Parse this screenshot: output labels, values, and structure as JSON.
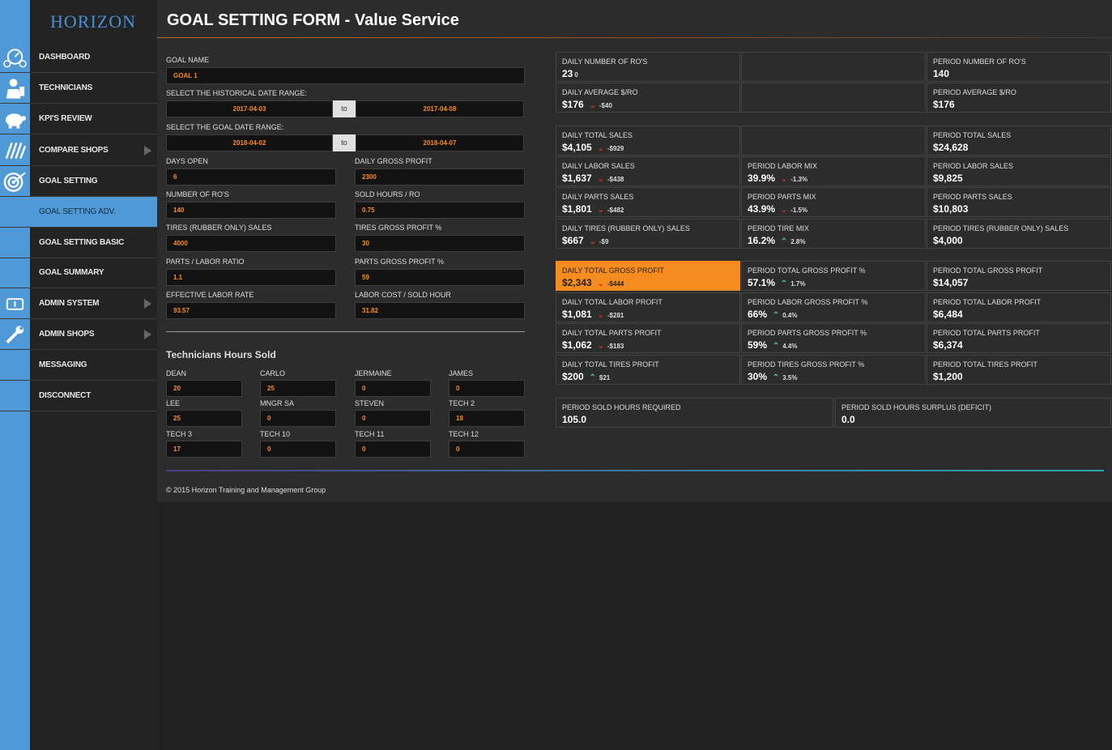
{
  "brand": "HORIZON",
  "page_title": "GOAL SETTING FORM - Value Service",
  "nav": [
    {
      "label": "DASHBOARD",
      "icon": "dashboard-icon"
    },
    {
      "label": "TECHNICIANS",
      "icon": "technician-icon"
    },
    {
      "label": "KPI'S REVIEW",
      "icon": "piggy-bank-icon"
    },
    {
      "label": "COMPARE SHOPS",
      "icon": "compare-icon"
    },
    {
      "label": "GOAL SETTING",
      "icon": "target-icon"
    },
    {
      "label": "GOAL SETTING ADV."
    },
    {
      "label": "GOAL SETTING BASIC"
    },
    {
      "label": "GOAL SUMMARY"
    },
    {
      "label": "ADMIN SYSTEM",
      "icon": "info-icon"
    },
    {
      "label": "ADMIN SHOPS",
      "icon": "wrench-icon"
    },
    {
      "label": "MESSAGING"
    },
    {
      "label": "DISCONNECT"
    }
  ],
  "form": {
    "goal_name_label": "GOAL NAME",
    "goal_name": "GOAL 1",
    "hist_label": "SELECT THE HISTORICAL DATE RANGE:",
    "hist_from": "2017-04-03",
    "hist_to": "2017-04-08",
    "goal_label": "SELECT THE GOAL DATE RANGE:",
    "goal_from": "2018-04-02",
    "goal_to": "2018-04-07",
    "to": "to",
    "fields": [
      {
        "label": "DAYS OPEN",
        "value": "6"
      },
      {
        "label": "DAILY GROSS PROFIT",
        "value": "2300"
      },
      {
        "label": "NUMBER OF RO'S",
        "value": "140"
      },
      {
        "label": "SOLD HOURS / RO",
        "value": "0.75"
      },
      {
        "label": "TIRES (RUBBER ONLY) SALES",
        "value": "4000"
      },
      {
        "label": "TIRES GROSS PROFIT %",
        "value": "30"
      },
      {
        "label": "PARTS / LABOR RATIO",
        "value": "1.1"
      },
      {
        "label": "PARTS GROSS PROFIT %",
        "value": "59"
      },
      {
        "label": "EFFECTIVE LABOR RATE",
        "value": "93.57"
      },
      {
        "label": "LABOR COST / SOLD HOUR",
        "value": "31.82"
      }
    ]
  },
  "technicians": {
    "title": "Technicians Hours Sold",
    "items": [
      {
        "name": "DEAN",
        "hours": "20"
      },
      {
        "name": "CARLO",
        "hours": "25"
      },
      {
        "name": "JERMAINE",
        "hours": "0"
      },
      {
        "name": "JAMES",
        "hours": "0"
      },
      {
        "name": "LEE",
        "hours": "25"
      },
      {
        "name": "MNGR SA",
        "hours": "0"
      },
      {
        "name": "STEVEN",
        "hours": "0"
      },
      {
        "name": "TECH 2",
        "hours": "18"
      },
      {
        "name": "TECH 3",
        "hours": "17"
      },
      {
        "name": "TECH 10",
        "hours": "0"
      },
      {
        "name": "TECH 11",
        "hours": "0"
      },
      {
        "name": "TECH 12",
        "hours": "0"
      }
    ]
  },
  "cards": [
    {
      "label": "DAILY NUMBER OF RO'S",
      "value": "23",
      "delta": "0"
    },
    {
      "label": "",
      "value": ""
    },
    {
      "label": "PERIOD NUMBER OF RO'S",
      "value": "140"
    },
    {
      "label": "DAILY AVERAGE $/RO",
      "value": "$176",
      "delta": "-$40",
      "dir": "down"
    },
    {
      "label": "",
      "value": ""
    },
    {
      "label": "PERIOD AVERAGE $/RO",
      "value": "$176"
    },
    {
      "label": "DAILY TOTAL SALES",
      "value": "$4,105",
      "delta": "-$929",
      "dir": "down"
    },
    {
      "label": "",
      "value": ""
    },
    {
      "label": "PERIOD TOTAL SALES",
      "value": "$24,628"
    },
    {
      "label": "DAILY LABOR SALES",
      "value": "$1,637",
      "delta": "-$438",
      "dir": "down"
    },
    {
      "label": "PERIOD LABOR MIX",
      "value": "39.9%",
      "delta": "-1.3%",
      "dir": "down"
    },
    {
      "label": "PERIOD LABOR SALES",
      "value": "$9,825"
    },
    {
      "label": "DAILY PARTS SALES",
      "value": "$1,801",
      "delta": "-$482",
      "dir": "down"
    },
    {
      "label": "PERIOD PARTS MIX",
      "value": "43.9%",
      "delta": "-1.5%",
      "dir": "down"
    },
    {
      "label": "PERIOD PARTS SALES",
      "value": "$10,803"
    },
    {
      "label": "DAILY TIRES (RUBBER ONLY) SALES",
      "value": "$667",
      "delta": "-$9",
      "dir": "down"
    },
    {
      "label": "PERIOD TIRE MIX",
      "value": "16.2%",
      "delta": "2.8%",
      "dir": "up"
    },
    {
      "label": "PERIOD TIRES (RUBBER ONLY) SALES",
      "value": "$4,000"
    },
    {
      "label": "DAILY TOTAL GROSS PROFIT",
      "value": "$2,343",
      "delta": "-$444",
      "dir": "down",
      "highlight": true
    },
    {
      "label": "PERIOD TOTAL GROSS PROFIT %",
      "value": "57.1%",
      "delta": "1.7%",
      "dir": "up"
    },
    {
      "label": "PERIOD TOTAL GROSS PROFIT",
      "value": "$14,057"
    },
    {
      "label": "DAILY TOTAL LABOR PROFIT",
      "value": "$1,081",
      "delta": "-$281",
      "dir": "down"
    },
    {
      "label": "PERIOD LABOR GROSS PROFIT %",
      "value": "66%",
      "delta": "0.4%",
      "dir": "up"
    },
    {
      "label": "PERIOD TOTAL LABOR PROFIT",
      "value": "$6,484"
    },
    {
      "label": "DAILY TOTAL PARTS PROFIT",
      "value": "$1,062",
      "delta": "-$183",
      "dir": "down"
    },
    {
      "label": "PERIOD PARTS GROSS PROFIT %",
      "value": "59%",
      "delta": "4.4%",
      "dir": "up"
    },
    {
      "label": "PERIOD TOTAL PARTS PROFIT",
      "value": "$6,374"
    },
    {
      "label": "DAILY TOTAL TIRES PROFIT",
      "value": "$200",
      "delta": "$21",
      "dir": "up"
    },
    {
      "label": "PERIOD TIRES GROSS PROFIT %",
      "value": "30%",
      "delta": "3.5%",
      "dir": "up"
    },
    {
      "label": "PERIOD TOTAL TIRES PROFIT",
      "value": "$1,200"
    },
    {
      "label": "PERIOD SOLD HOURS REQUIRED",
      "value": "105.0"
    },
    {
      "label": "PERIOD SOLD HOURS SURPLUS (DEFICIT)",
      "value": "0.0"
    }
  ],
  "footer": "© 2015 Horizon Training and Management Group",
  "colors": {
    "accent_blue": "#4f9ad6",
    "highlight_orange": "#f68b1f",
    "up": "#54c79b",
    "down": "#c9302c",
    "input_text": "#ff8c1a"
  }
}
